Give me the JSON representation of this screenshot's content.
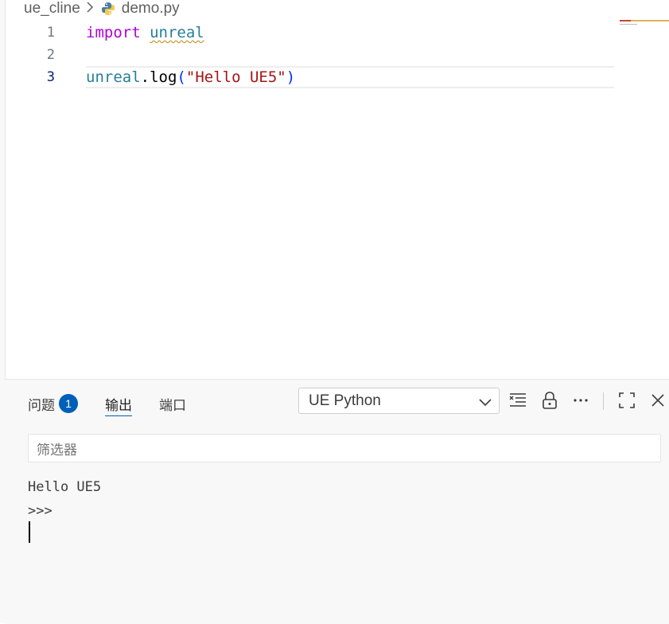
{
  "breadcrumb": {
    "folder": "ue_cline",
    "file": "demo.py"
  },
  "editor": {
    "lines": [
      {
        "number": "1",
        "keyword": "import",
        "module": "unreal"
      },
      {
        "number": "2"
      },
      {
        "number": "3",
        "object": "unreal",
        "dot": ".",
        "method": "log",
        "open_paren": "(",
        "string": "\"Hello UE5\"",
        "close_paren": ")"
      }
    ],
    "active_line": "3"
  },
  "panel": {
    "tabs": [
      {
        "label": "问题",
        "badge": "1"
      },
      {
        "label": "输出",
        "active": true
      },
      {
        "label": "端口"
      }
    ],
    "channel_select": "UE Python",
    "filter_placeholder": "筛选器",
    "output_lines": [
      "Hello UE5",
      ">>>"
    ]
  },
  "colors": {
    "accent": "#005fb8",
    "keyword": "#af00db",
    "module": "#267f99",
    "string": "#a31515",
    "warning_squiggle": "#bf8803"
  },
  "icons": [
    "python-file-icon",
    "chevron-right-icon",
    "chevron-down-icon",
    "clear-output-icon",
    "lock-icon",
    "more-actions-icon",
    "maximize-icon",
    "close-icon"
  ]
}
